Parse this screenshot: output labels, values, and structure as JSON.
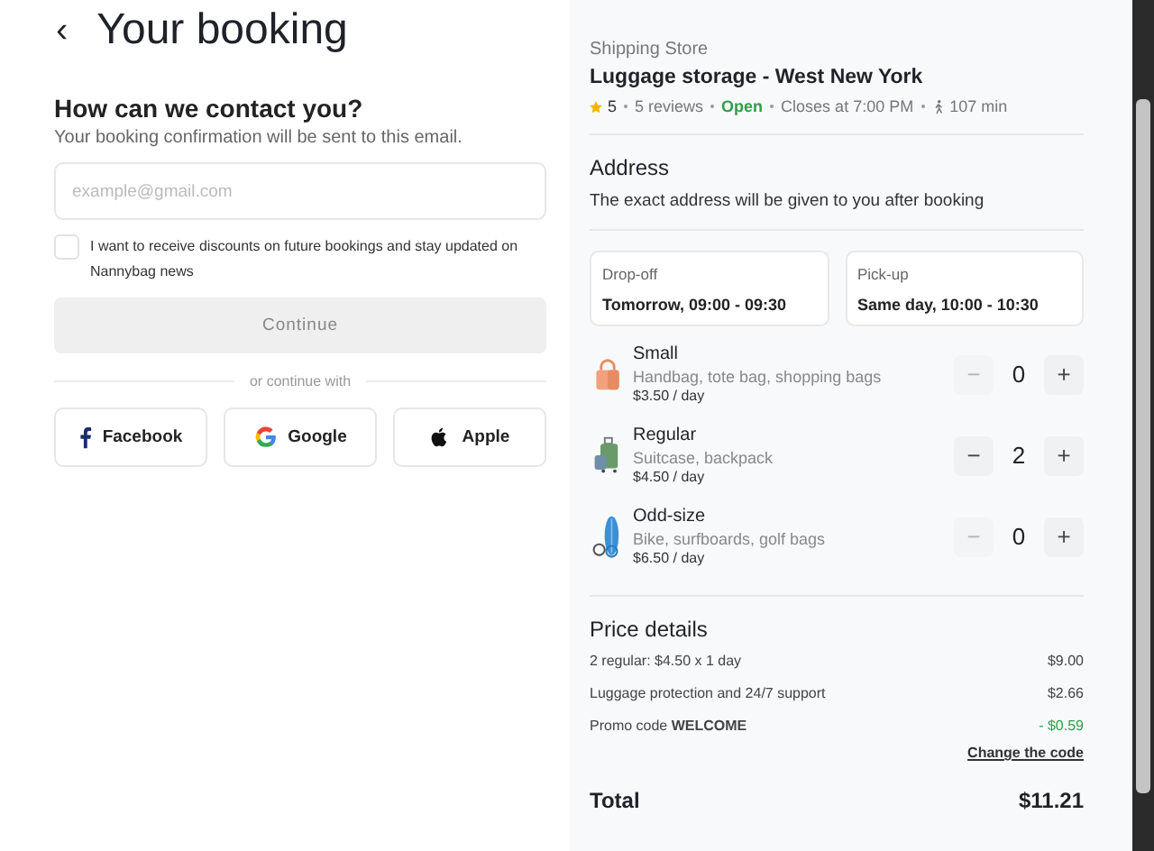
{
  "header": {
    "back": "‹",
    "title": "Your booking"
  },
  "contact": {
    "heading": "How can we contact you?",
    "subtitle": "Your booking confirmation will be sent to this email.",
    "email": {
      "placeholder": "example@gmail.com"
    },
    "consent": {
      "label": "I want to receive discounts on future bookings and stay updated on Nannybag news",
      "checked": false
    },
    "continue": {
      "label": "Continue",
      "disabled": true
    },
    "divider": "or continue with",
    "social": [
      {
        "kind": "facebook",
        "label": "Facebook"
      },
      {
        "kind": "google",
        "label": "Google"
      },
      {
        "kind": "apple",
        "label": "Apple"
      }
    ]
  },
  "store": {
    "category": "Shipping Store",
    "name": "Luggage storage - West New York",
    "rating": "5",
    "reviews": "5 reviews",
    "status": "Open",
    "closes": "Closes at 7:00 PM",
    "walk": "107 min"
  },
  "address": {
    "heading": "Address",
    "text": "The exact address will be given to you after booking"
  },
  "times": [
    {
      "label": "Drop-off",
      "value": "Tomorrow, 09:00 - 09:30"
    },
    {
      "label": "Pick-up",
      "value": "Same day, 10:00 - 10:30"
    }
  ],
  "luggage": [
    {
      "kind": "small",
      "name": "Small",
      "description": "Handbag, tote bag, shopping bags",
      "price": "$3.50 / day",
      "minus": "−",
      "quantity": "0",
      "plus": "+",
      "minus_disabled": true
    },
    {
      "kind": "regular",
      "name": "Regular",
      "description": "Suitcase, backpack",
      "price": "$4.50 / day",
      "minus": "−",
      "quantity": "2",
      "plus": "+",
      "minus_disabled": false
    },
    {
      "kind": "oddsize",
      "name": "Odd-size",
      "description": "Bike, surfboards, golf bags",
      "price": "$6.50 / day",
      "minus": "−",
      "quantity": "0",
      "plus": "+",
      "minus_disabled": true
    }
  ],
  "price_details": {
    "heading": "Price details",
    "lines": [
      {
        "label": "2 regular: $4.50 x 1 day",
        "amount": "$9.00",
        "discount": false
      },
      {
        "label": "Luggage protection and 24/7 support",
        "amount": "$2.66",
        "discount": false
      },
      {
        "label": "Promo code **WELCOME**",
        "amount": "- $0.59",
        "discount": true
      }
    ],
    "change_link": "Change the code",
    "total_label": "Total",
    "total": "$11.21"
  }
}
